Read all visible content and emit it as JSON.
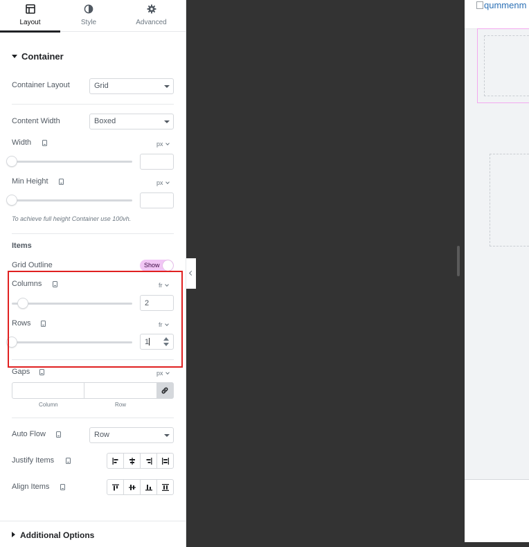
{
  "tabs": [
    {
      "label": "Layout",
      "icon": "layout-icon",
      "active": true
    },
    {
      "label": "Style",
      "icon": "half-circle-icon",
      "active": false
    },
    {
      "label": "Advanced",
      "icon": "gear-icon",
      "active": false
    }
  ],
  "section": {
    "title": "Container"
  },
  "container_layout": {
    "label": "Container Layout",
    "value": "Grid"
  },
  "content_width": {
    "label": "Content Width",
    "value": "Boxed"
  },
  "width": {
    "label": "Width",
    "unit": "px",
    "value": "",
    "slider_level": 0
  },
  "min_height": {
    "label": "Min Height",
    "unit": "px",
    "value": "",
    "slider_level": 0,
    "hint": "To achieve full height Container use 100vh."
  },
  "items": {
    "heading": "Items"
  },
  "grid_outline": {
    "label": "Grid Outline",
    "toggle_text": "Show",
    "on": true
  },
  "columns": {
    "label": "Columns",
    "unit": "fr",
    "value": "2"
  },
  "rows": {
    "label": "Rows",
    "unit": "fr",
    "value": "1"
  },
  "gaps": {
    "label": "Gaps",
    "unit": "px",
    "column_label": "Column",
    "row_label": "Row"
  },
  "auto_flow": {
    "label": "Auto Flow",
    "value": "Row"
  },
  "justify_items": {
    "label": "Justify Items"
  },
  "align_items": {
    "label": "Align Items"
  },
  "additional_options": {
    "title": "Additional Options"
  },
  "preview": {
    "logo_alt": "qummenm"
  },
  "colors": {
    "highlight": "#e02020",
    "toggle": "#f1c6f5",
    "outline": "#f3a8ef",
    "canvas": "#333333"
  }
}
